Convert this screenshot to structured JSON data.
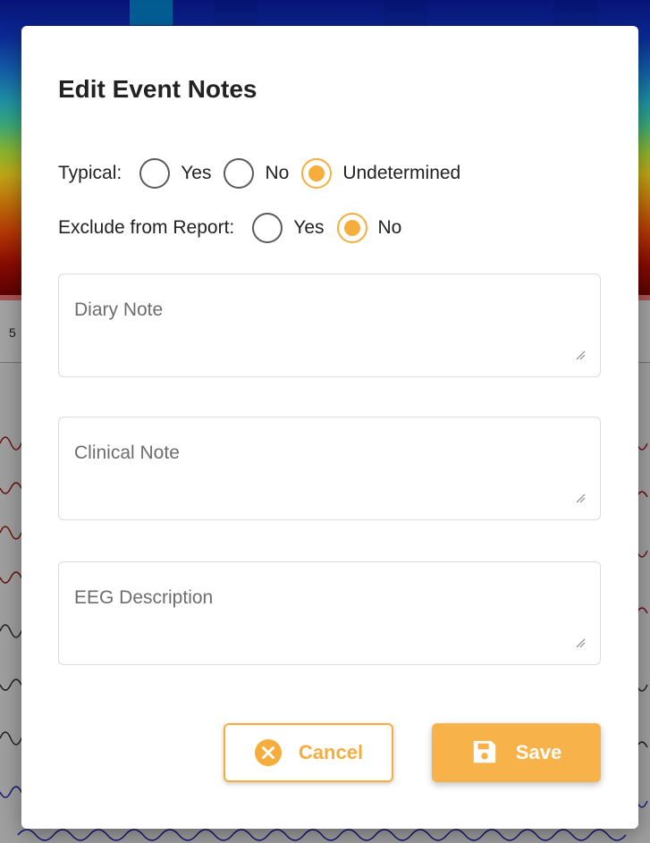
{
  "background": {
    "ruler_label": "5"
  },
  "dialog": {
    "title": "Edit Event Notes",
    "typical": {
      "label": "Typical:",
      "options": [
        "Yes",
        "No",
        "Undetermined"
      ],
      "selected": "Undetermined"
    },
    "exclude_from_report": {
      "label": "Exclude from Report:",
      "options": [
        "Yes",
        "No"
      ],
      "selected": "No"
    },
    "fields": {
      "diary_note": {
        "placeholder": "Diary Note",
        "value": ""
      },
      "clinical_note": {
        "placeholder": "Clinical Note",
        "value": ""
      },
      "eeg_description": {
        "placeholder": "EEG Description",
        "value": ""
      }
    },
    "buttons": {
      "cancel": {
        "label": "Cancel",
        "icon": "cancel-circle-icon"
      },
      "save": {
        "label": "Save",
        "icon": "floppy-disk-icon"
      }
    }
  },
  "colors": {
    "accent": "#f7ad3c",
    "save_button": "#f7b34a"
  }
}
